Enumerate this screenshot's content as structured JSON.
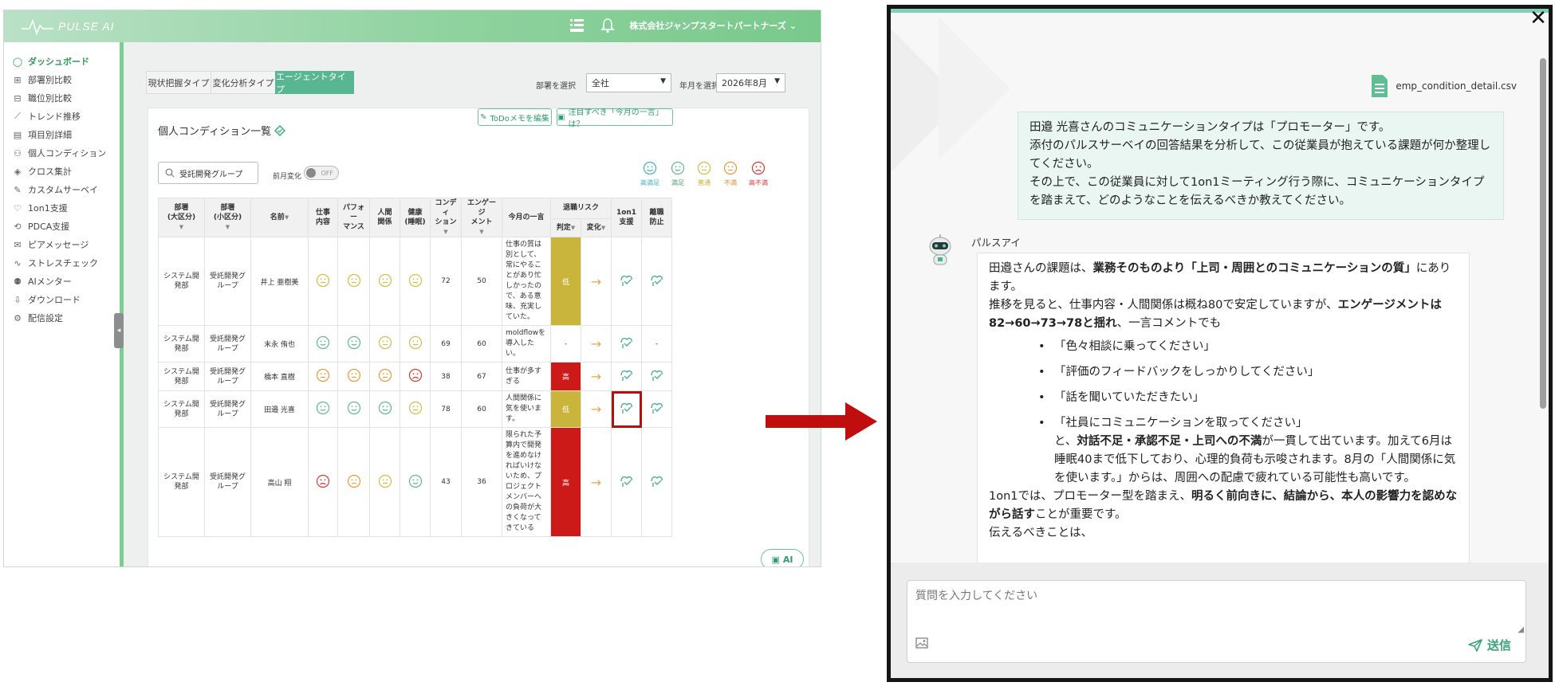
{
  "app": {
    "logo": "PULSE AI",
    "company": "株式会社ジャンプスタートパートナーズ",
    "colors": {
      "accent": "#58b792",
      "brand": "#79c98c",
      "risk_high": "#cc1a18",
      "risk_low": "#c9b53c",
      "highlight": "#b41010"
    }
  },
  "sidebar": {
    "items": [
      {
        "label": "ダッシュボード",
        "icon": "circle-icon"
      },
      {
        "label": "部署別比較",
        "icon": "org-chart-icon"
      },
      {
        "label": "職位別比較",
        "icon": "hierarchy-icon"
      },
      {
        "label": "トレンド推移",
        "icon": "line-chart-icon"
      },
      {
        "label": "項目別詳細",
        "icon": "bar-chart-icon"
      },
      {
        "label": "個人コンディション",
        "icon": "people-icon"
      },
      {
        "label": "クロス集計",
        "icon": "cross-icon"
      },
      {
        "label": "カスタムサーベイ",
        "icon": "survey-icon"
      },
      {
        "label": "1on1支援",
        "icon": "heart-hand-icon"
      },
      {
        "label": "PDCA支援",
        "icon": "cycle-icon"
      },
      {
        "label": "ピアメッセージ",
        "icon": "message-icon"
      },
      {
        "label": "ストレスチェック",
        "icon": "stress-icon"
      },
      {
        "label": "AIメンター",
        "icon": "mentor-icon"
      },
      {
        "label": "ダウンロード",
        "icon": "download-icon"
      },
      {
        "label": "配信設定",
        "icon": "settings-icon"
      }
    ]
  },
  "tabs": [
    {
      "label": "現状把握タイプ"
    },
    {
      "label": "変化分析タイプ"
    },
    {
      "label": "エージェントタイプ"
    }
  ],
  "filters": {
    "dept_label": "部署を選択",
    "dept_value": "全社",
    "month_label": "年月を選択",
    "month_value": "2026年8月"
  },
  "panel": {
    "title": "個人コンディション一覧",
    "todo_button": "ToDoメモを編集",
    "notice_button": "注目すべき「今月の一言」は？",
    "search_value": "受託開発グループ",
    "prev_change_label": "前月変化",
    "toggle_label": "OFF",
    "legend": [
      "高満足",
      "満足",
      "普通",
      "不満",
      "高不満"
    ]
  },
  "table": {
    "headers": {
      "dept_large": "部署\n(大区分)",
      "dept_small": "部署\n(小区分)",
      "name": "名前",
      "work": "仕事\n内容",
      "performance": "パフォー\nマンス",
      "relation": "人間\n関係",
      "health": "健康\n(睡眠)",
      "condition": "コンディ\nション",
      "engagement": "エンゲージ\nメント",
      "comment": "今月の一言",
      "risk": "退職リスク",
      "risk_judge": "判定",
      "risk_change": "変化",
      "oneonone": "1on1\n支援",
      "retention": "離職\n防止"
    },
    "rows": [
      {
        "dept1": "システム開発部",
        "dept2": "受託開発グループ",
        "name": "井上 亜樹美",
        "faces": [
          "ok",
          "ok",
          "ok",
          "ok"
        ],
        "condition": "72",
        "engagement": "50",
        "comment": "仕事の質は別として、常にやることがあり忙しかったので、ある意味、充実していた。",
        "risk": "低",
        "risk_level": "low",
        "retention": "icon"
      },
      {
        "dept1": "システム開発部",
        "dept2": "受託開発グループ",
        "name": "末永 侑也",
        "faces": [
          "good",
          "good",
          "neutral",
          "neutral"
        ],
        "condition": "69",
        "engagement": "60",
        "comment": "moldflowを導入したい。",
        "risk": "-",
        "risk_level": "none",
        "retention": "-"
      },
      {
        "dept1": "システム開発部",
        "dept2": "受託開発グループ",
        "name": "橋本 直樹",
        "faces": [
          "bad",
          "bad",
          "bad",
          "worst"
        ],
        "condition": "38",
        "engagement": "67",
        "comment": "仕事が多すぎる",
        "risk": "高",
        "risk_level": "high",
        "retention": "icon"
      },
      {
        "dept1": "システム開発部",
        "dept2": "受託開発グループ",
        "name": "田邉 光喜",
        "faces": [
          "good",
          "good",
          "good",
          "neutral"
        ],
        "condition": "78",
        "engagement": "60",
        "comment": "人間関係に気を使います。",
        "risk": "低",
        "risk_level": "low",
        "retention": "icon"
      },
      {
        "dept1": "システム開発部",
        "dept2": "受託開発グループ",
        "name": "高山 翔",
        "faces": [
          "worst",
          "bad",
          "neutral",
          "good"
        ],
        "condition": "43",
        "engagement": "36",
        "comment": "限られた予算内で開発を進めなければいけないため、プロジェクトメンバーへの負荷が大きくなってきている",
        "risk": "高",
        "risk_level": "high",
        "retention": "icon"
      }
    ]
  },
  "ai_button": "AI",
  "chat": {
    "attachment_name": "emp_condition_detail.csv",
    "user_message": [
      "田邉 光喜さんのコミュニケーションタイプは「プロモーター」です。",
      "添付のパルスサーベイの回答結果を分析して、この従業員が抱えている課題が何か整理してください。",
      "その上で、この従業員に対して1on1ミーティング行う際に、コミュニケーションタイプを踏まえて、どのようなことを伝えるべきか教えてください。"
    ],
    "bot_name": "パルスアイ",
    "bot": {
      "p1_pre": "田邉さんの課題は、",
      "p1_bold": "業務そのものより「上司・周囲とのコミュニケーションの質」",
      "p1_post": "にあります。",
      "p2_pre": "推移を見ると、仕事内容・人間関係は概ね80で安定していますが、",
      "p2_bold": "エンゲージメントは82→60→73→78と揺れ",
      "p2_post": "、一言コメントでも",
      "bullets": [
        "「色々相談に乗ってください」",
        "「評価のフィードバックをしっかりしてください」",
        "「話を聞いていただきたい」",
        "「社員にコミュニケーションを取ってください」"
      ],
      "p3_pre": "と、",
      "p3_bold": "対話不足・承認不足・上司への不満",
      "p3_post": "が一貫して出ています。加えて6月は睡眠40まで低下しており、心理的負荷も示唆されます。8月の「人間関係に気を使います。」からは、周囲への配慮で疲れている可能性も高いです。",
      "p4_pre": "1on1では、プロモーター型を踏まえ、",
      "p4_bold": "明るく前向きに、結論から、本人の影響力を認めながら話す",
      "p4_post": "ことが重要です。",
      "p5": "伝えるべきことは、"
    },
    "input_placeholder": "質問を入力してください",
    "send_label": "送信"
  }
}
